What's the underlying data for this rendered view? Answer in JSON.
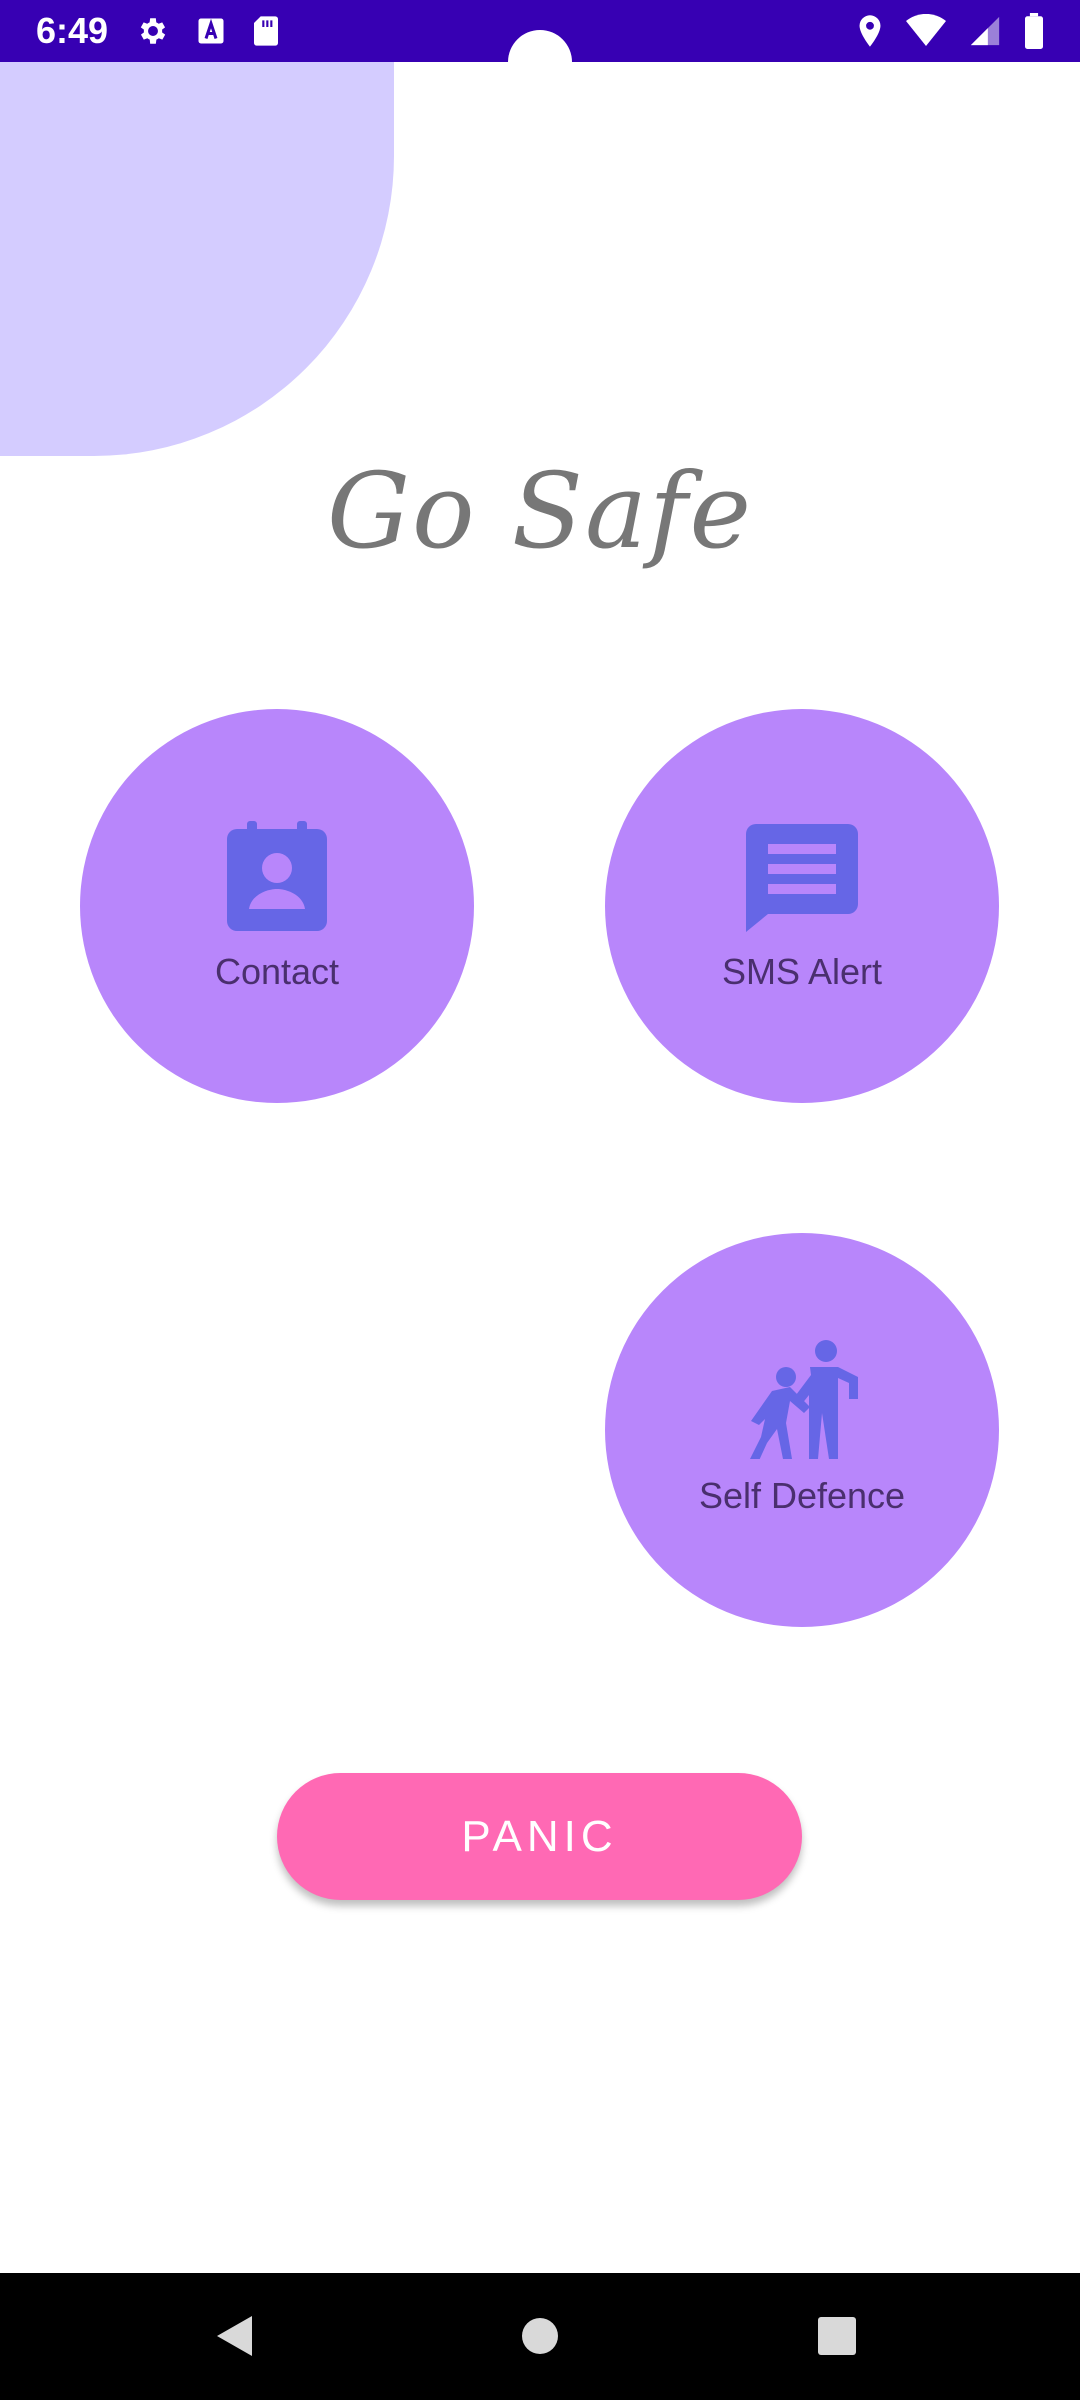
{
  "status_bar": {
    "time": "6:49",
    "background": "#3700b3",
    "left_icons": [
      "settings-gear-icon",
      "text-a-icon",
      "sd-card-icon"
    ],
    "right_icons": [
      "location-pin-icon",
      "wifi-icon",
      "cell-signal-icon",
      "battery-icon"
    ]
  },
  "app": {
    "title": "Go Safe"
  },
  "features": {
    "contact_label": "Contact",
    "sms_label": "SMS Alert",
    "defence_label": "Self Defence",
    "circle_color": "#b886fb",
    "icon_color": "#6666e6"
  },
  "panic": {
    "label": "PANIC",
    "color": "#ff69b4"
  },
  "nav_bar": {
    "buttons": [
      "back-icon",
      "home-icon",
      "recents-icon"
    ]
  }
}
